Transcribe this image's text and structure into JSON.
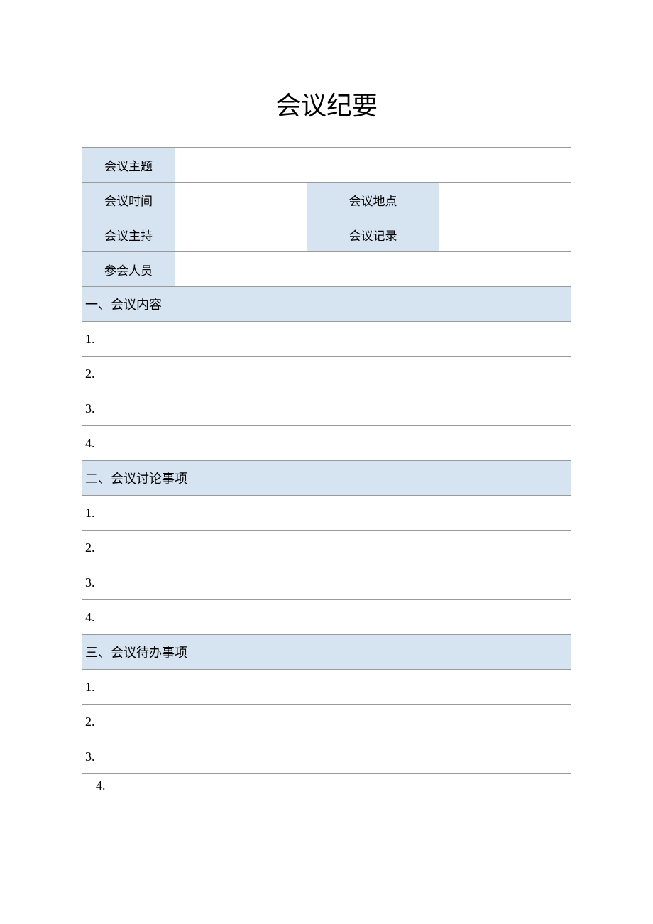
{
  "title": "会议纪要",
  "header": {
    "subject_label": "会议主题",
    "subject_value": "",
    "time_label": "会议时间",
    "time_value": "",
    "location_label": "会议地点",
    "location_value": "",
    "host_label": "会议主持",
    "host_value": "",
    "record_label": "会议记录",
    "record_value": "",
    "attendees_label": "参会人员",
    "attendees_value": ""
  },
  "sections": [
    {
      "heading": "一、会议内容",
      "items": [
        "1.",
        "2.",
        "3.",
        "4."
      ]
    },
    {
      "heading": "二、会议讨论事项",
      "items": [
        "1.",
        "2.",
        "3.",
        "4."
      ]
    },
    {
      "heading": "三、会议待办事项",
      "items": [
        "1.",
        "2.",
        "3."
      ]
    }
  ],
  "trailing_item": "4."
}
